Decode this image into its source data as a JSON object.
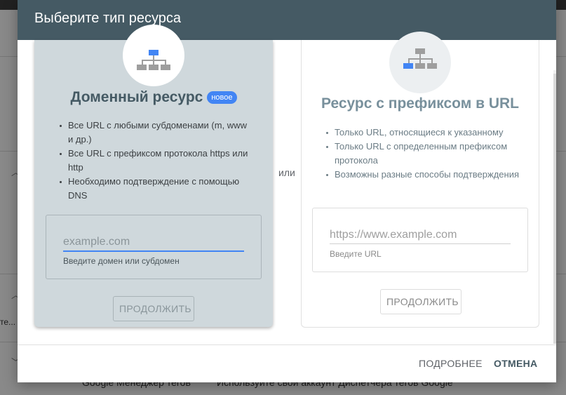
{
  "dialog": {
    "title": "Выберите тип ресурса",
    "or_label": "или",
    "footer": {
      "learn_more": "ПОДРОБНЕЕ",
      "cancel": "ОТМЕНА"
    }
  },
  "domain_card": {
    "icon": "sitemap-icon",
    "title": "Доменный ресурс",
    "badge": "новое",
    "bullets": [
      "Все URL с любыми субдоменами (m, www и др.)",
      "Все URL с префиксом протокола https или http",
      "Необходимо подтверждение с помощью DNS"
    ],
    "input_placeholder": "example.com",
    "input_value": "",
    "helper": "Введите домен или субдомен",
    "continue": "ПРОДОЛЖИТЬ"
  },
  "url_card": {
    "icon": "sitemap-icon",
    "title": "Ресурс с префиксом в URL",
    "bullets": [
      "Только URL, относящиеся к указанному",
      "Только URL с определенным префиксом протокола",
      "Возможны разные способы подтверждения"
    ],
    "input_placeholder": "https://www.example.com",
    "input_value": "",
    "helper": "Введите URL",
    "continue": "ПРОДОЛЖИТЬ"
  },
  "background": {
    "side_text": "те...",
    "bottom_left": "Google Менеджер тегов",
    "bottom_right": "Используйте свой аккаунт Диспетчера тегов Google"
  },
  "colors": {
    "header": "#455a64",
    "accent": "#4285f4",
    "domain_card_bg": "#cfd8dc"
  }
}
